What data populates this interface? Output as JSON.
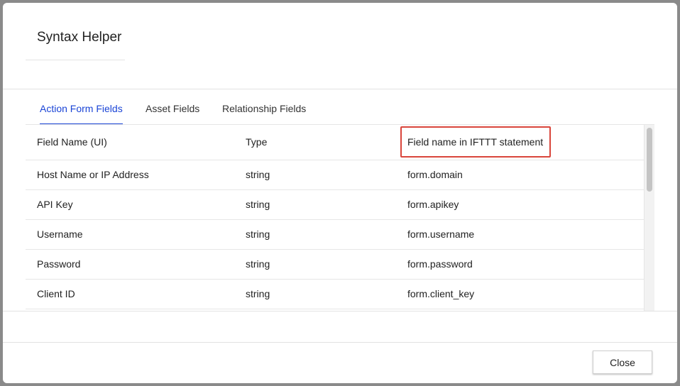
{
  "dialog": {
    "title": "Syntax Helper",
    "close_label": "Close"
  },
  "tabs": [
    {
      "label": "Action Form Fields",
      "active": true
    },
    {
      "label": "Asset Fields",
      "active": false
    },
    {
      "label": "Relationship Fields",
      "active": false
    }
  ],
  "table": {
    "headers": [
      "Field Name (UI)",
      "Type",
      "Field name in IFTTT statement"
    ],
    "rows": [
      [
        "Host Name or IP Address",
        "string",
        "form.domain"
      ],
      [
        "API Key",
        "string",
        "form.apikey"
      ],
      [
        "Username",
        "string",
        "form.username"
      ],
      [
        "Password",
        "string",
        "form.password"
      ],
      [
        "Client ID",
        "string",
        "form.client_key"
      ]
    ]
  },
  "colors": {
    "accent": "#1a44d6",
    "highlight_border": "#d9453b"
  }
}
